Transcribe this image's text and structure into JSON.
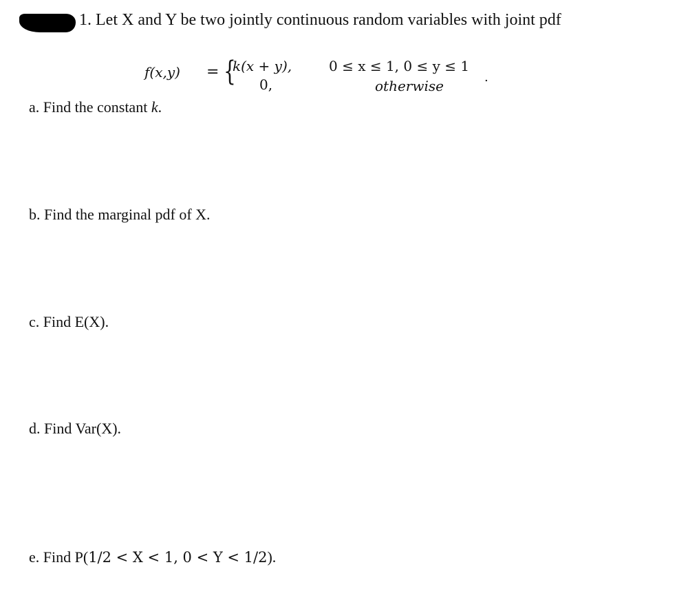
{
  "question": {
    "title": "1. Let X and Y be two jointly continuous random variables with joint pdf",
    "pdf": {
      "lhs": "f(x,y)",
      "equals": "=",
      "case1_expr": "k(x + y),",
      "case1_cond": "0 ≤ x ≤ 1, 0 ≤ y ≤ 1",
      "case2_expr": "0,",
      "case2_cond": "otherwise",
      "trailing": "."
    },
    "parts": {
      "a_prefix": "a. Find the constant ",
      "a_var": "k",
      "a_suffix": ".",
      "b": "b. Find the marginal pdf of X.",
      "c": "c. Find E(X).",
      "d": "d. Find Var(X).",
      "e_prefix": "e. Find P(",
      "e_math": "1/2 < X < 1, 0 < Y < 1/2",
      "e_suffix": ")."
    }
  }
}
